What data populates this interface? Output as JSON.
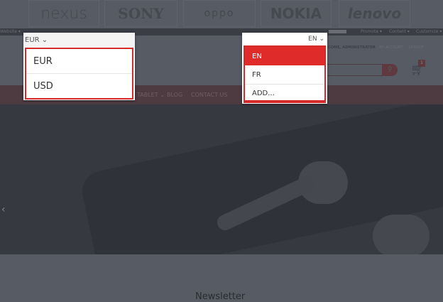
{
  "brands": [
    "nexus",
    "SONY",
    "oppo",
    "NOKIA",
    "lenovo"
  ],
  "admin_bar": {
    "website": "Website ▾",
    "menus": [
      "Promote ▾",
      "Content ▾",
      "Customize ▾"
    ]
  },
  "user_links": {
    "welcome": "WELCOME, ADMINISTRATOR",
    "account": "MY ACCOUNT",
    "logout": "LOGOUT"
  },
  "cart": {
    "count": "1"
  },
  "nav": {
    "items": [
      "TABLET ⌄",
      "BLOG",
      "CONTACT US"
    ]
  },
  "currency": {
    "selected": "EUR",
    "options": [
      "EUR",
      "USD"
    ]
  },
  "language": {
    "selected": "EN",
    "options": [
      "EN",
      "FR",
      "ADD..."
    ]
  },
  "carousel": {
    "prev": "‹"
  },
  "footer": {
    "newsletter": "Newsletter"
  },
  "colors": {
    "accent": "#e02b2b",
    "overlay": "#575b64"
  }
}
